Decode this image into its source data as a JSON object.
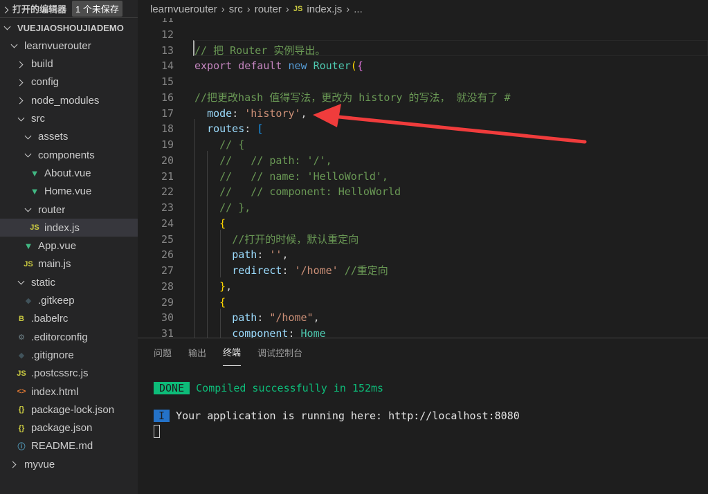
{
  "sidebar": {
    "open_editors_label": "打开的编辑器",
    "unsaved_badge": "1 个未保存",
    "tree": [
      {
        "label": "VUEJIAOSHOUJIADEMO",
        "indent": 0,
        "kind": "open",
        "root": true
      },
      {
        "label": "learnvuerouter",
        "indent": 1,
        "kind": "open"
      },
      {
        "label": "build",
        "indent": 2,
        "kind": "closed"
      },
      {
        "label": "config",
        "indent": 2,
        "kind": "closed"
      },
      {
        "label": "node_modules",
        "indent": 2,
        "kind": "closed"
      },
      {
        "label": "src",
        "indent": 2,
        "kind": "open"
      },
      {
        "label": "assets",
        "indent": 3,
        "kind": "open"
      },
      {
        "label": "components",
        "indent": 3,
        "kind": "open"
      },
      {
        "label": "About.vue",
        "indent": 4,
        "kind": "file",
        "icon": "vue-icon"
      },
      {
        "label": "Home.vue",
        "indent": 4,
        "kind": "file",
        "icon": "vue-icon"
      },
      {
        "label": "router",
        "indent": 3,
        "kind": "open"
      },
      {
        "label": "index.js",
        "indent": 4,
        "kind": "file",
        "icon": "js-icon",
        "selected": true
      },
      {
        "label": "App.vue",
        "indent": 3,
        "kind": "file",
        "icon": "vue-icon"
      },
      {
        "label": "main.js",
        "indent": 3,
        "kind": "file",
        "icon": "js-icon"
      },
      {
        "label": "static",
        "indent": 2,
        "kind": "open"
      },
      {
        "label": ".gitkeep",
        "indent": 3,
        "kind": "file",
        "icon": "git-icon"
      },
      {
        "label": ".babelrc",
        "indent": 2,
        "kind": "file",
        "icon": "babel-icon"
      },
      {
        "label": ".editorconfig",
        "indent": 2,
        "kind": "file",
        "icon": "gear-icon"
      },
      {
        "label": ".gitignore",
        "indent": 2,
        "kind": "file",
        "icon": "git-icon"
      },
      {
        "label": ".postcssrc.js",
        "indent": 2,
        "kind": "file",
        "icon": "js-icon"
      },
      {
        "label": "index.html",
        "indent": 2,
        "kind": "file",
        "icon": "html-icon"
      },
      {
        "label": "package-lock.json",
        "indent": 2,
        "kind": "file",
        "icon": "json-icon"
      },
      {
        "label": "package.json",
        "indent": 2,
        "kind": "file",
        "icon": "json-icon"
      },
      {
        "label": "README.md",
        "indent": 2,
        "kind": "file",
        "icon": "info-icon"
      },
      {
        "label": "myvue",
        "indent": 1,
        "kind": "closed"
      }
    ]
  },
  "breadcrumb": {
    "parts": [
      "learnvuerouter",
      "src",
      "router"
    ],
    "file": "index.js",
    "file_icon": "JS",
    "more": "..."
  },
  "editor": {
    "lines": [
      {
        "n": "11",
        "tokens": []
      },
      {
        "n": "12",
        "tokens": []
      },
      {
        "n": "13",
        "tokens": [
          [
            "c",
            "// 把 Router 实例导出。"
          ]
        ]
      },
      {
        "n": "14",
        "tokens": [
          [
            "k",
            "export"
          ],
          [
            "w",
            " "
          ],
          [
            "k",
            "default"
          ],
          [
            "w",
            " "
          ],
          [
            "b",
            "new"
          ],
          [
            "w",
            " "
          ],
          [
            "t",
            "Router"
          ],
          [
            "y",
            "("
          ],
          [
            "m",
            "{"
          ]
        ]
      },
      {
        "n": "15",
        "tokens": []
      },
      {
        "n": "16",
        "tokens": [
          [
            "c",
            "//把更改hash 值得写法，更改为 history 的写法， 就没有了 #"
          ]
        ]
      },
      {
        "n": "17",
        "tokens": [
          [
            "w",
            "  "
          ],
          [
            "p",
            "mode"
          ],
          [
            "w",
            ": "
          ],
          [
            "s",
            "'history'"
          ],
          [
            "w",
            ","
          ]
        ]
      },
      {
        "n": "18",
        "tokens": [
          [
            "w",
            "  "
          ],
          [
            "p",
            "routes"
          ],
          [
            "w",
            ": "
          ],
          [
            "bl",
            "["
          ]
        ]
      },
      {
        "n": "19",
        "tokens": [
          [
            "w",
            "    "
          ],
          [
            "c",
            "// {"
          ]
        ]
      },
      {
        "n": "20",
        "tokens": [
          [
            "w",
            "    "
          ],
          [
            "c",
            "//   // path: '/',"
          ]
        ]
      },
      {
        "n": "21",
        "tokens": [
          [
            "w",
            "    "
          ],
          [
            "c",
            "//   // name: 'HelloWorld',"
          ]
        ]
      },
      {
        "n": "22",
        "tokens": [
          [
            "w",
            "    "
          ],
          [
            "c",
            "//   // component: HelloWorld"
          ]
        ]
      },
      {
        "n": "23",
        "tokens": [
          [
            "w",
            "    "
          ],
          [
            "c",
            "// },"
          ]
        ]
      },
      {
        "n": "24",
        "tokens": [
          [
            "w",
            "    "
          ],
          [
            "y",
            "{"
          ]
        ]
      },
      {
        "n": "25",
        "tokens": [
          [
            "w",
            "      "
          ],
          [
            "c",
            "//打开的时候，默认重定向"
          ]
        ]
      },
      {
        "n": "26",
        "tokens": [
          [
            "w",
            "      "
          ],
          [
            "p",
            "path"
          ],
          [
            "w",
            ": "
          ],
          [
            "s",
            "''"
          ],
          [
            "w",
            ","
          ]
        ]
      },
      {
        "n": "27",
        "tokens": [
          [
            "w",
            "      "
          ],
          [
            "p",
            "redirect"
          ],
          [
            "w",
            ": "
          ],
          [
            "s",
            "'/home'"
          ],
          [
            "w",
            " "
          ],
          [
            "c",
            "//重定向"
          ]
        ]
      },
      {
        "n": "28",
        "tokens": [
          [
            "w",
            "    "
          ],
          [
            "y",
            "}"
          ],
          [
            "w",
            ","
          ]
        ]
      },
      {
        "n": "29",
        "tokens": [
          [
            "w",
            "    "
          ],
          [
            "y",
            "{"
          ]
        ]
      },
      {
        "n": "30",
        "tokens": [
          [
            "w",
            "      "
          ],
          [
            "p",
            "path"
          ],
          [
            "w",
            ": "
          ],
          [
            "s",
            "\"/home\""
          ],
          [
            "w",
            ","
          ]
        ]
      },
      {
        "n": "31",
        "tokens": [
          [
            "w",
            "      "
          ],
          [
            "p",
            "component"
          ],
          [
            "w",
            ": "
          ],
          [
            "t",
            "Home"
          ]
        ]
      }
    ]
  },
  "panel": {
    "tabs": [
      {
        "label": "问题"
      },
      {
        "label": "输出"
      },
      {
        "label": "终端",
        "active": true
      },
      {
        "label": "调试控制台"
      }
    ],
    "terminal": {
      "done_badge": "DONE",
      "done_text": "Compiled successfully in 152ms",
      "info_badge": "I",
      "info_text": "Your application is running here: http://localhost:8080"
    }
  },
  "colors": {
    "annotation_arrow": "#f03c3c",
    "done_badge": "#0dbc79",
    "info_badge": "#2472c8"
  }
}
